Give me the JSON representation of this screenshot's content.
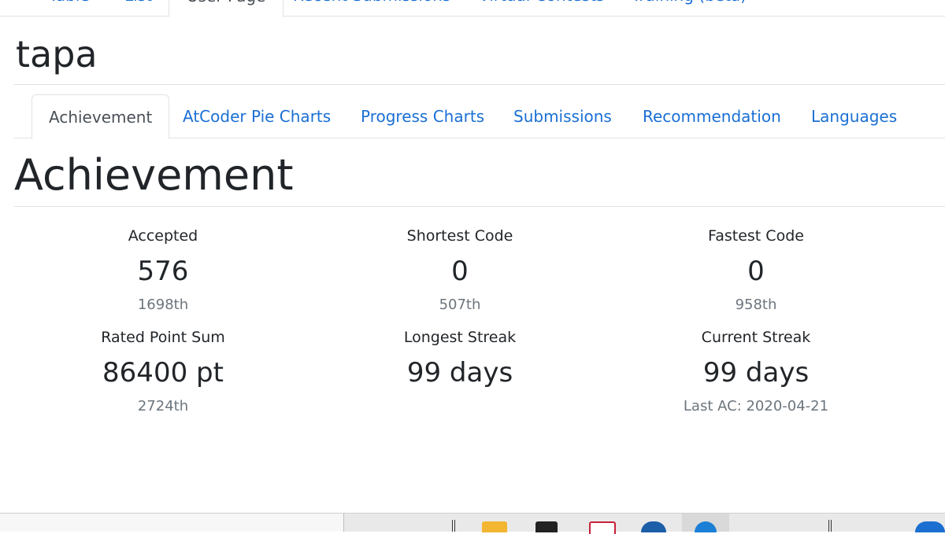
{
  "top_nav": {
    "tabs": [
      {
        "label": "Table"
      },
      {
        "label": "List"
      },
      {
        "label": "User Page"
      },
      {
        "label": "Recent Submissions"
      },
      {
        "label": "Virtual Contests"
      },
      {
        "label": "Training (beta)"
      }
    ]
  },
  "user": {
    "name": "tapa"
  },
  "sub_tabs": [
    {
      "label": "Achievement"
    },
    {
      "label": "AtCoder Pie Charts"
    },
    {
      "label": "Progress Charts"
    },
    {
      "label": "Submissions"
    },
    {
      "label": "Recommendation"
    },
    {
      "label": "Languages"
    }
  ],
  "section": {
    "title": "Achievement"
  },
  "stats": {
    "accepted": {
      "label": "Accepted",
      "value": "576",
      "rank": "1698th"
    },
    "shortest_code": {
      "label": "Shortest Code",
      "value": "0",
      "rank": "507th"
    },
    "fastest_code": {
      "label": "Fastest Code",
      "value": "0",
      "rank": "958th"
    },
    "rated_point_sum": {
      "label": "Rated Point Sum",
      "value": "86400 pt",
      "rank": "2724th"
    },
    "longest_streak": {
      "label": "Longest Streak",
      "value": "99 days"
    },
    "current_streak": {
      "label": "Current Streak",
      "value": "99 days",
      "last_ac": "Last AC: 2020-04-21"
    }
  },
  "taskbar": {
    "icons": [
      "file-explorer-icon",
      "store-icon",
      "app-icon",
      "mail-icon",
      "browser-icon",
      "edge-icon"
    ]
  }
}
